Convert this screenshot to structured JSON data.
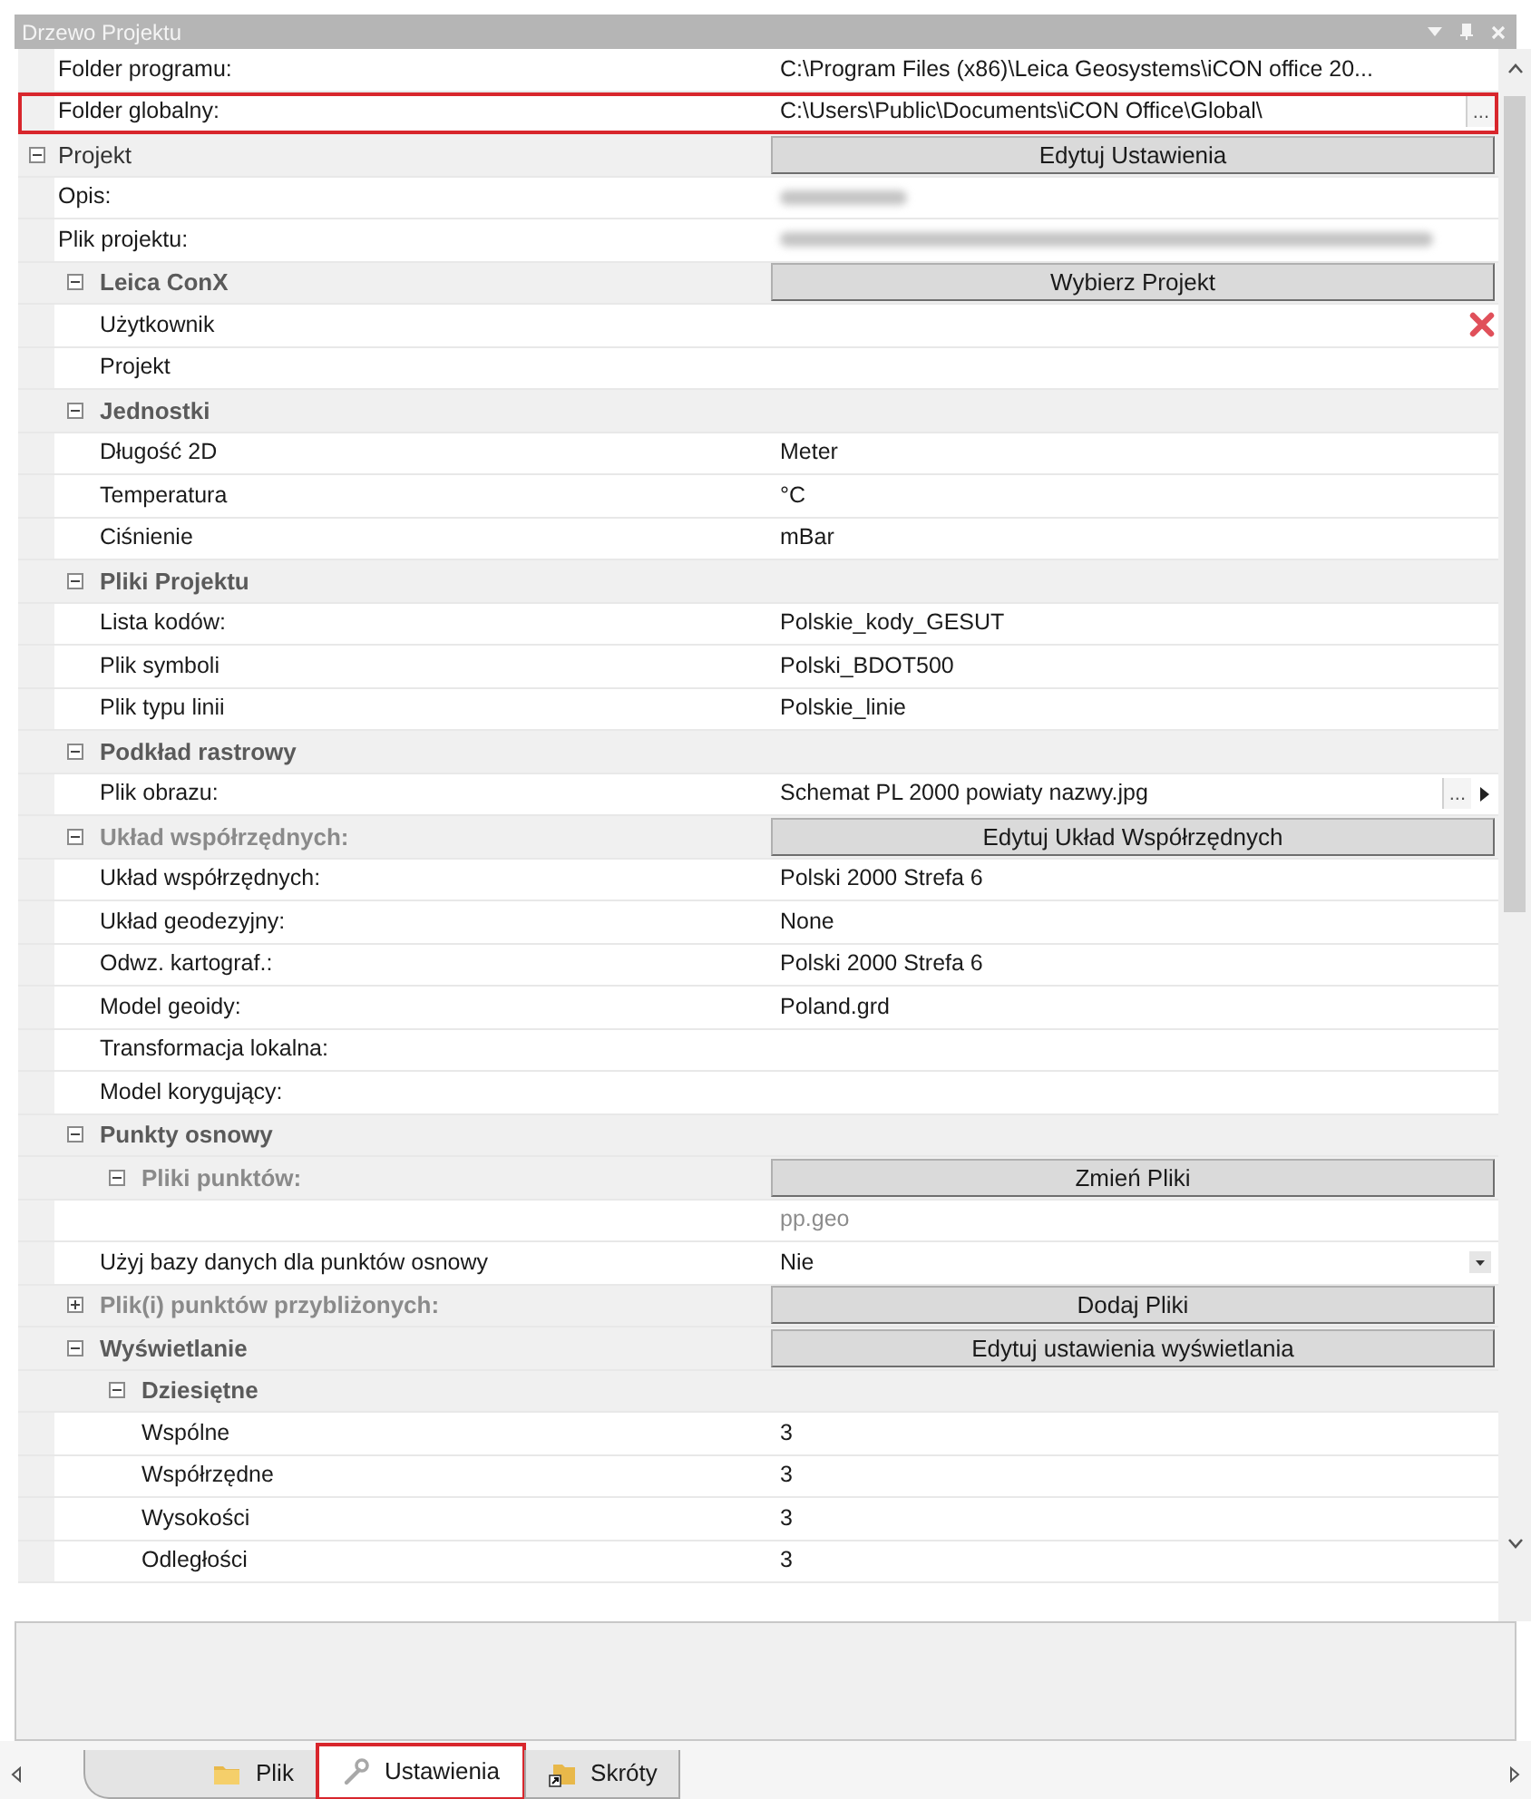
{
  "panel": {
    "title": "Drzewo Projektu"
  },
  "rows": [
    {
      "kind": "property",
      "label": "Folder programu:",
      "value": "C:\\Program Files (x86)\\Leica Geosystems\\iCON office 20..."
    },
    {
      "kind": "browse",
      "label": "Folder globalny:",
      "value": "C:\\Users\\Public\\Documents\\iCON Office\\Global\\",
      "browse": "...",
      "highlighted": true
    },
    {
      "kind": "category",
      "label": "Projekt",
      "expanded": true,
      "dimmed": false,
      "button": "Edytuj Ustawienia",
      "children": [
        {
          "kind": "redacted",
          "label": "Opis:"
        },
        {
          "kind": "redacted",
          "label": "Plik projektu:"
        },
        {
          "kind": "category",
          "label": "Leica ConX",
          "expanded": true,
          "dimmed": false,
          "button": "Wybierz Projekt",
          "children": [
            {
              "kind": "clear",
              "label": "Użytkownik"
            },
            {
              "kind": "property",
              "label": "Projekt"
            }
          ]
        },
        {
          "kind": "category",
          "label": "Jednostki",
          "expanded": true,
          "dimmed": false,
          "children": [
            {
              "kind": "property",
              "label": "Długość 2D",
              "value": "Meter"
            },
            {
              "kind": "property",
              "label": "Temperatura",
              "value": "°C"
            },
            {
              "kind": "property",
              "label": "Ciśnienie",
              "value": "mBar"
            }
          ]
        },
        {
          "kind": "category",
          "label": "Pliki Projektu",
          "expanded": true,
          "dimmed": false,
          "children": [
            {
              "kind": "property",
              "label": "Lista kodów:",
              "value": "Polskie_kody_GESUT"
            },
            {
              "kind": "property",
              "label": "Plik symboli",
              "value": "Polski_BDOT500"
            },
            {
              "kind": "property",
              "label": "Plik typu linii",
              "value": "Polskie_linie"
            }
          ]
        },
        {
          "kind": "category",
          "label": "Podkład rastrowy",
          "expanded": true,
          "dimmed": false,
          "children": [
            {
              "kind": "browse",
              "label": "Plik obrazu:",
              "value": "Schemat PL 2000 powiaty nazwy.jpg",
              "browse": "...",
              "highlighted": false
            }
          ]
        },
        {
          "kind": "category",
          "label": "Układ współrzędnych:",
          "expanded": true,
          "dimmed": true,
          "button": "Edytuj Układ Współrzędnych",
          "children": [
            {
              "kind": "property",
              "label": "Układ współrzędnych:",
              "value": "Polski 2000 Strefa 6"
            },
            {
              "kind": "property",
              "label": "Układ geodezyjny:",
              "value": "None"
            },
            {
              "kind": "property",
              "label": "Odwz. kartograf.:",
              "value": "Polski 2000 Strefa 6"
            },
            {
              "kind": "property",
              "label": "Model geoidy:",
              "value": "Poland.grd"
            },
            {
              "kind": "property",
              "label": "Transformacja lokalna:"
            },
            {
              "kind": "property",
              "label": "Model korygujący:"
            }
          ]
        },
        {
          "kind": "category",
          "label": "Punkty osnowy",
          "expanded": true,
          "dimmed": false,
          "children": [
            {
              "kind": "category",
              "label": "Pliki punktów:",
              "expanded": true,
              "dimmed": true,
              "button": "Zmień Pliki",
              "children": [
                {
                  "kind": "file",
                  "value": "pp.geo"
                }
              ]
            },
            {
              "kind": "dropdown",
              "label": "Użyj bazy danych dla punktów osnowy",
              "value": "Nie"
            }
          ]
        },
        {
          "kind": "category",
          "label": "Plik(i) punktów przybliżonych:",
          "expanded": false,
          "dimmed": true,
          "button": "Dodaj Pliki"
        },
        {
          "kind": "category",
          "label": "Wyświetlanie",
          "expanded": true,
          "dimmed": false,
          "button": "Edytuj ustawienia wyświetlania",
          "children": [
            {
              "kind": "category",
              "label": "Dziesiętne",
              "expanded": true,
              "dimmed": false,
              "children": [
                {
                  "kind": "property",
                  "label": "Wspólne",
                  "value": "3"
                },
                {
                  "kind": "property",
                  "label": "Współrzędne",
                  "value": "3"
                },
                {
                  "kind": "property",
                  "label": "Wysokości",
                  "value": "3"
                },
                {
                  "kind": "property",
                  "label": "Odległości",
                  "value": "3"
                }
              ]
            }
          ]
        }
      ]
    }
  ],
  "tabs": [
    {
      "label": "Plik",
      "selected": false,
      "highlighted": false
    },
    {
      "label": "Ustawienia",
      "selected": true,
      "highlighted": true
    },
    {
      "label": "Skróty",
      "selected": false,
      "highlighted": false
    }
  ]
}
